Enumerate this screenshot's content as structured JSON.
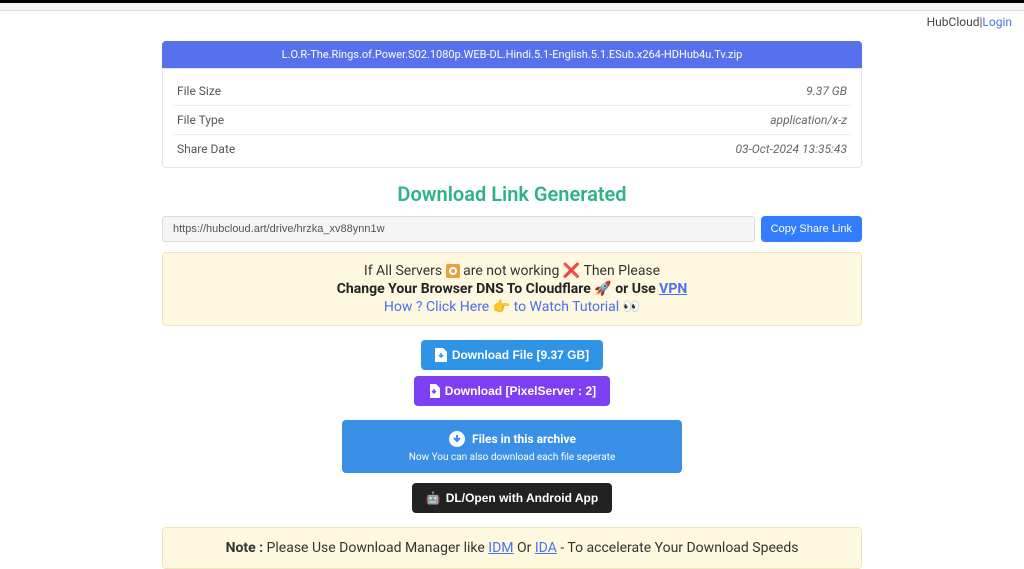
{
  "header": {
    "brand": "HubCloud",
    "sep": " | ",
    "login": "Login"
  },
  "file": {
    "title": "L.O.R-The.Rings.of.Power.S02.1080p.WEB-DL.Hindi.5.1-English.5.1.ESub.x264-HDHub4u.Tv.zip",
    "rows": [
      {
        "label": "File Size",
        "value": "9.37 GB"
      },
      {
        "label": "File Type",
        "value": "application/x-z"
      },
      {
        "label": "Share Date",
        "value": "03-Oct-2024 13:35:43"
      }
    ]
  },
  "generated": "Download Link Generated",
  "share": {
    "url": "https://hubcloud.art/drive/hrzka_xv88ynn1w",
    "copy": "Copy Share Link"
  },
  "notice": {
    "l1a": "If All Servers ",
    "l1b": " are not working ",
    "cross": "❌",
    "l1c": " Then Please",
    "l2a": "Change Your Browser DNS To Cloudflare ",
    "rocket": "🚀",
    "l2b": " or Use ",
    "vpn": "VPN",
    "l3a": "How ? Click Here ",
    "point": "👉",
    "l3b": " to Watch Tutorial ",
    "eyes": "👀"
  },
  "dl": {
    "file": "Download File [9.37 GB]",
    "pixel": "Download [PixelServer : 2]"
  },
  "archive": {
    "top": "Files in this archive",
    "sub": "Now You can also download each file seperate"
  },
  "android": {
    "label": "DL/Open with Android App",
    "emoji": "🤖"
  },
  "note": {
    "lbl": "Note : ",
    "text1": "Please Use Download Manager like ",
    "dm1": "IDM",
    "or": " Or ",
    "dm2": "IDA",
    "text2": " - To accelerate Your Download Speeds"
  }
}
